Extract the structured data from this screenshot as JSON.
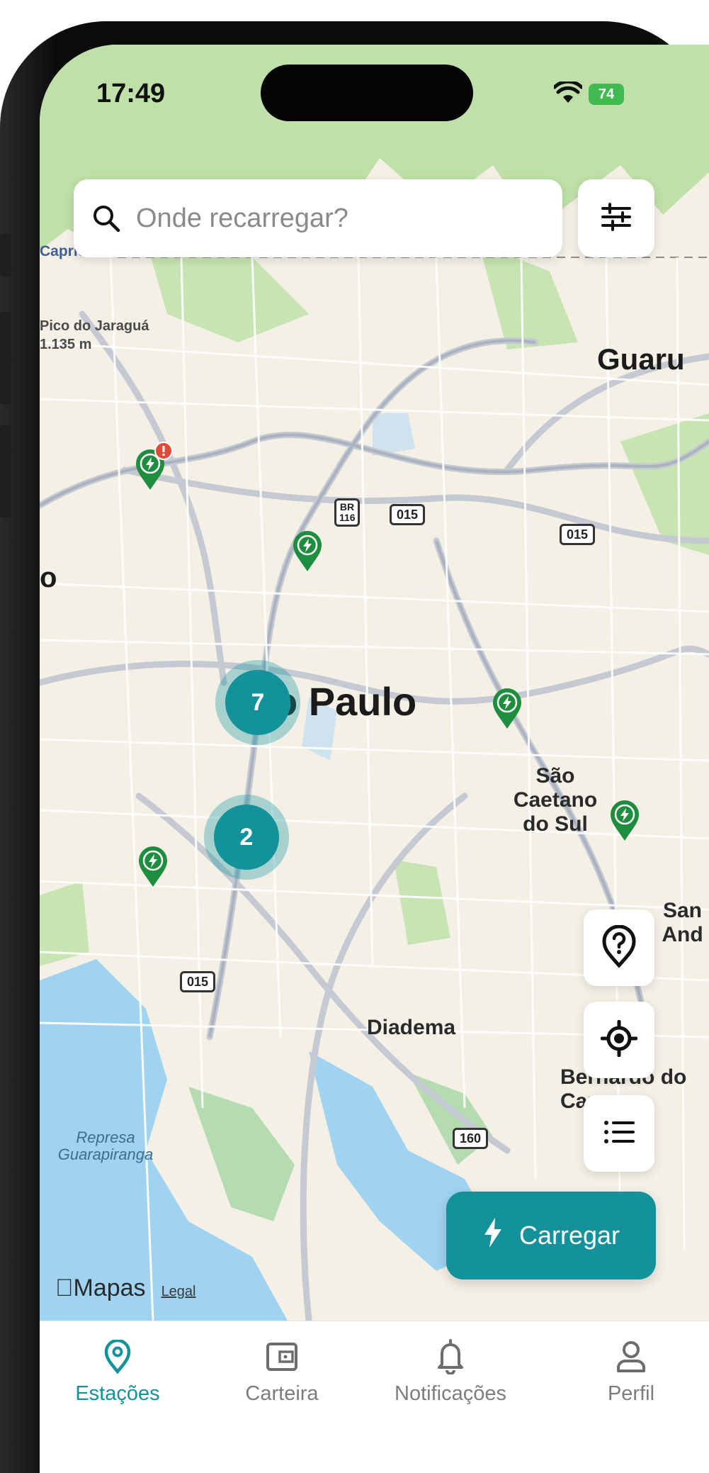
{
  "status_bar": {
    "time": "17:49",
    "battery": "74"
  },
  "search": {
    "placeholder": "Onde recarregar?"
  },
  "map": {
    "labels": {
      "capricornio": "Capricórnio",
      "pico_name": "Pico do Jaraguá",
      "pico_alt": "1.135 m",
      "guarulhos": "Guaru",
      "sao_paulo": "o Paulo",
      "sao_caetano": "São Caetano do Sul",
      "santo_andre": "San And",
      "diadema": "Diadema",
      "sao_bernardo": "Bernardo do Campo",
      "represa": "Represa Guarapiranga",
      "left_edge": "o"
    },
    "road_shields": {
      "br116": "BR 116",
      "r015_a": "015",
      "r015_b": "015",
      "r015_c": "015",
      "r160": "160"
    },
    "clusters": {
      "c1": "7",
      "c2": "2"
    },
    "maps_logo": "Mapas",
    "legal": "Legal"
  },
  "charge_button": {
    "label": "Carregar"
  },
  "tabbar": {
    "tabs": [
      {
        "label": "Estações",
        "icon": "map-pin-icon",
        "active": true
      },
      {
        "label": "Carteira",
        "icon": "wallet-icon",
        "active": false
      },
      {
        "label": "Notificações",
        "icon": "bell-icon",
        "active": false
      },
      {
        "label": "Perfil",
        "icon": "user-icon",
        "active": false
      }
    ]
  },
  "colors": {
    "accent": "#13929b",
    "pin": "#1e8e3e",
    "alert": "#e04a3a"
  }
}
